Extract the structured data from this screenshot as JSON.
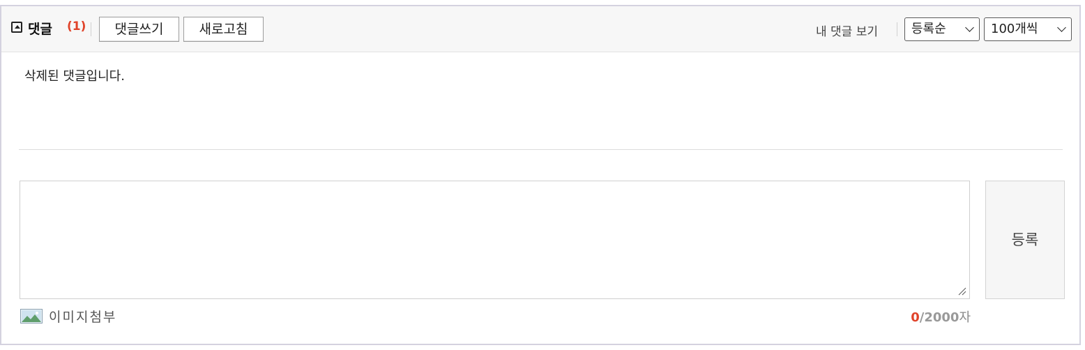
{
  "header": {
    "title": "댓글",
    "count": "(1)",
    "write_button": "댓글쓰기",
    "refresh_button": "새로고침",
    "my_comments_link": "내 댓글 보기",
    "sort_select": "등록순",
    "page_size_select": "100개씩"
  },
  "comments": [
    {
      "text": "삭제된 댓글입니다."
    }
  ],
  "editor": {
    "textarea_value": "",
    "submit_button": "등록",
    "attach_image_label": "이미지첨부",
    "char_count_current": "0",
    "char_count_max": "/2000",
    "char_count_unit": "자"
  },
  "colors": {
    "accent": "#e0432a",
    "border": "#d4d2df"
  }
}
